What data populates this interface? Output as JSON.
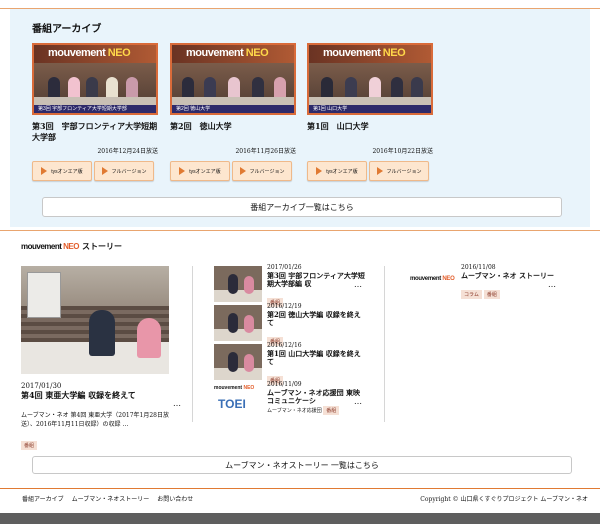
{
  "archive": {
    "title": "番組アーカイブ",
    "items": [
      {
        "title": "第3回　宇部フロンティア大学短期大学部",
        "date": "2016年12月24日放送",
        "caption": "第3回 宇部フロンティア大学短期大学部",
        "btn_oa": "tysオンエア版",
        "btn_full": "フルバージョン"
      },
      {
        "title": "第2回　徳山大学",
        "date": "2016年11月26日放送",
        "caption": "第2回 徳山大学",
        "btn_oa": "tysオンエア版",
        "btn_full": "フルバージョン"
      },
      {
        "title": "第1回　山口大学",
        "date": "2016年10月22日放送",
        "caption": "第1回 山口大学",
        "btn_oa": "tysオンエア版",
        "btn_full": "フルバージョン"
      }
    ],
    "more_label": "番組アーカイブ一覧はこちら"
  },
  "story": {
    "brand_a": "mouvement",
    "brand_b": "NEO",
    "label": "ストーリー",
    "feature": {
      "date": "2017/01/30",
      "title": "第4回 東亜大学編 収録を終えて",
      "dots": "…",
      "excerpt": "ムーブマン・ネオ 第4回 東亜大学（2017年1月28日放送）、2016年11月11日収録）の収録 …",
      "tag": "番組"
    },
    "items": [
      {
        "date": "2017/01/26",
        "title": "第3回 宇部フロンティア大学短期大学部編 収",
        "dots": "…",
        "tags": [
          "番組"
        ]
      },
      {
        "date": "2016/12/19",
        "title": "第2回 徳山大学編 収録を終えて",
        "dots": "",
        "tags": [
          "番組"
        ]
      },
      {
        "date": "2016/12/16",
        "title": "第1回 山口大学編 収録を終えて",
        "dots": "",
        "tags": [
          "番組"
        ]
      },
      {
        "date": "2016/11/09",
        "title": "ムーブマン・ネオ応援団 東映コミュニケーシ",
        "dots": "…",
        "subtitle": "ムーブマン・ネオ応援団",
        "tags": [
          "番組"
        ]
      }
    ],
    "side_item": {
      "date": "2016/11/08",
      "title": "ムーブマン・ネオ ストーリー",
      "dots": "…",
      "tags": [
        "コラム",
        "番組"
      ]
    },
    "toei_text": "TOEI",
    "more_label": "ムーブマン・ネオストーリー 一覧はこちら"
  },
  "footer": {
    "nav": [
      "番組アーカイブ",
      "ムーブマン・ネオストーリー",
      "お問い合わせ"
    ],
    "copyright": "Copyright © 山口県くすぐりプロジェクト ムーブマン・ネオ"
  },
  "colors": {
    "accent": "#e35d2a",
    "archive_bg": "#e9f4fb",
    "rule": "#e9a56f"
  }
}
